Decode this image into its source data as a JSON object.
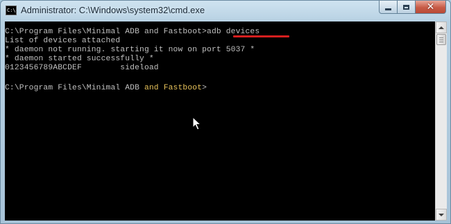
{
  "window": {
    "title": "Administrator: C:\\Windows\\system32\\cmd.exe",
    "icon_text": "C:\\",
    "controls": {
      "minimize": "minimize-icon",
      "maximize": "maximize-icon",
      "close": "close-icon",
      "close_glyph": "✕"
    }
  },
  "console": {
    "prompt1": "C:\\Program Files\\Minimal ADB and Fastboot>",
    "command": "adb devices",
    "output": [
      "List of devices attached",
      "* daemon not running. starting it now on port 5037 *",
      "* daemon started successfully *",
      "0123456789ABCDEF        sideload"
    ],
    "prompt2_parts": [
      "C:\\Program Files\\Minimal ADB ",
      "and",
      " ",
      "Fastboot",
      ">"
    ],
    "colors": {
      "background": "#000000",
      "text": "#c0c0c0",
      "highlight": "#e7c25a",
      "underline": "#d61f1f"
    }
  },
  "scrollbar": {
    "up_icon": "scroll-up-arrow-icon",
    "down_icon": "scroll-down-arrow-icon"
  }
}
